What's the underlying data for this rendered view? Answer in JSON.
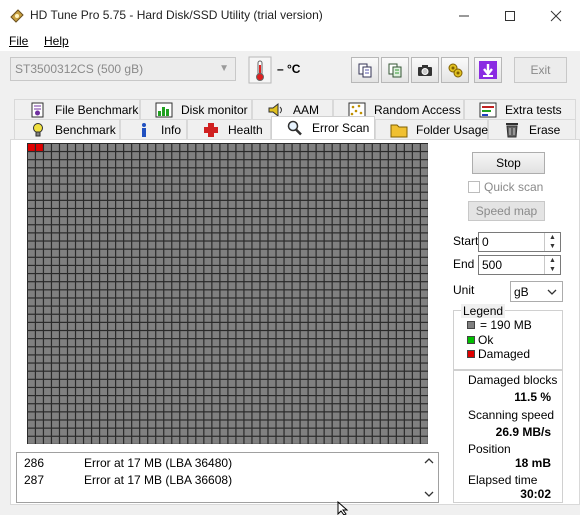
{
  "window": {
    "title": "HD Tune Pro 5.75 - Hard Disk/SSD Utility (trial version)"
  },
  "menu": {
    "file": "File",
    "help": "Help"
  },
  "toolbar": {
    "drive": "ST3500312CS (500 gB)",
    "temperature": "– °C",
    "exit_label": "Exit"
  },
  "tabs_row1": [
    {
      "label": "File Benchmark",
      "icon": "file-benchmark-icon"
    },
    {
      "label": "Disk monitor",
      "icon": "disk-monitor-icon"
    },
    {
      "label": "AAM",
      "icon": "speaker-icon"
    },
    {
      "label": "Random Access",
      "icon": "random-access-icon"
    },
    {
      "label": "Extra tests",
      "icon": "extra-tests-icon"
    }
  ],
  "tabs_row2": [
    {
      "label": "Benchmark",
      "icon": "benchmark-icon"
    },
    {
      "label": "Info",
      "icon": "info-icon"
    },
    {
      "label": "Health",
      "icon": "health-icon"
    },
    {
      "label": "Error Scan",
      "icon": "magnifier-icon",
      "active": true
    },
    {
      "label": "Folder Usage",
      "icon": "folder-icon"
    },
    {
      "label": "Erase",
      "icon": "trash-icon"
    }
  ],
  "scan": {
    "grid_columns": 50,
    "grid_rows": 37,
    "damaged_blocks": [
      0,
      1
    ],
    "colors": {
      "ok": "#00c000",
      "damaged": "#e00000",
      "untested": "#808080"
    }
  },
  "log": [
    {
      "index": "286",
      "message": "Error at 17 MB (LBA 36480)"
    },
    {
      "index": "287",
      "message": "Error at 17 MB (LBA 36608)"
    }
  ],
  "controls": {
    "stop_label": "Stop",
    "quick_scan_label": "Quick scan",
    "speed_map_label": "Speed map",
    "start_label": "Start",
    "start_value": "0",
    "end_label": "End",
    "end_value": "500",
    "unit_label": "Unit",
    "unit_value": "gB"
  },
  "legend": {
    "title": "Legend",
    "block": "= 190 MB",
    "ok": "Ok",
    "damaged": "Damaged"
  },
  "stats": {
    "damaged_label": "Damaged blocks",
    "damaged_value": "11.5 %",
    "speed_label": "Scanning speed",
    "speed_value": "26.9 MB/s",
    "position_label": "Position",
    "position_value": "18 mB",
    "elapsed_label": "Elapsed time",
    "elapsed_value": "30:02"
  }
}
